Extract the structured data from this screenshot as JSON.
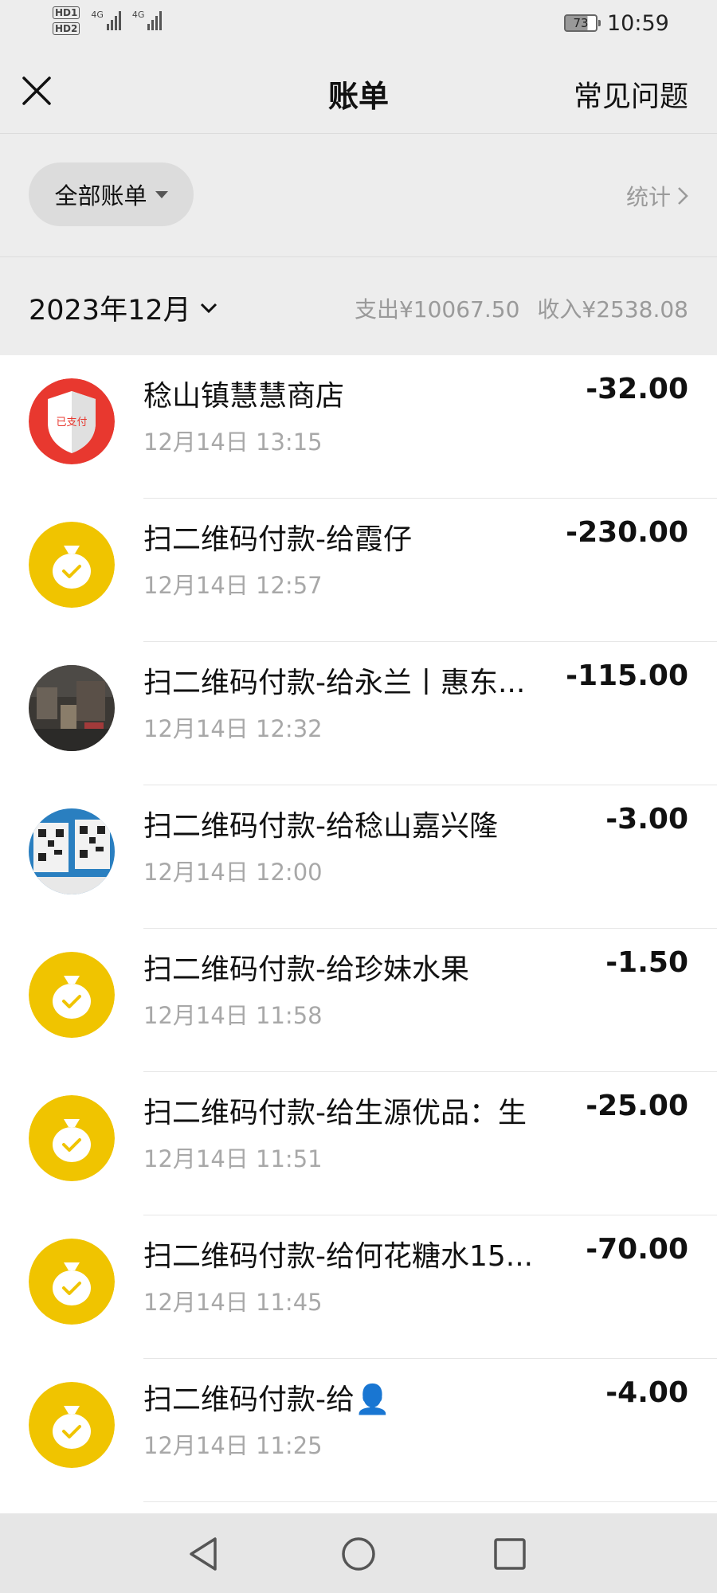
{
  "status_bar": {
    "sim1": "HD1",
    "sim2": "HD2",
    "network1": "4G",
    "network2": "4G",
    "battery": "73",
    "time": "10:59"
  },
  "header": {
    "title": "账单",
    "faq": "常见问题",
    "close_icon": "close-icon"
  },
  "filter": {
    "label": "全部账单",
    "stats": "统计"
  },
  "month": {
    "label": "2023年12月",
    "expense": "支出¥10067.50",
    "income": "收入¥2538.08"
  },
  "colors": {
    "coin_yellow": "#f0c400",
    "background": "#ededed"
  },
  "bills": [
    {
      "name": "稔山镇慧慧商店",
      "time": "12月14日 13:15",
      "amount": "-32.00",
      "avatar": "shield-paid-icon",
      "avatar_text": "已支付"
    },
    {
      "name": "扫二维码付款-给霞仔",
      "time": "12月14日 12:57",
      "amount": "-230.00",
      "avatar": "money-bag-icon"
    },
    {
      "name": "扫二维码付款-给永兰丨惠东...",
      "time": "12月14日 12:32",
      "amount": "-115.00",
      "avatar": "shop-photo"
    },
    {
      "name": "扫二维码付款-给稔山嘉兴隆",
      "time": "12月14日 12:00",
      "amount": "-3.00",
      "avatar": "qr-code-photo"
    },
    {
      "name": "扫二维码付款-给珍妹水果",
      "time": "12月14日 11:58",
      "amount": "-1.50",
      "avatar": "money-bag-icon"
    },
    {
      "name": "扫二维码付款-给生源优品：生",
      "time": "12月14日 11:51",
      "amount": "-25.00",
      "avatar": "money-bag-icon"
    },
    {
      "name": "扫二维码付款-给何花糖水15...",
      "time": "12月14日 11:45",
      "amount": "-70.00",
      "avatar": "money-bag-icon"
    },
    {
      "name": "扫二维码付款-给👤",
      "time": "12月14日 11:25",
      "amount": "-4.00",
      "avatar": "money-bag-icon"
    }
  ]
}
